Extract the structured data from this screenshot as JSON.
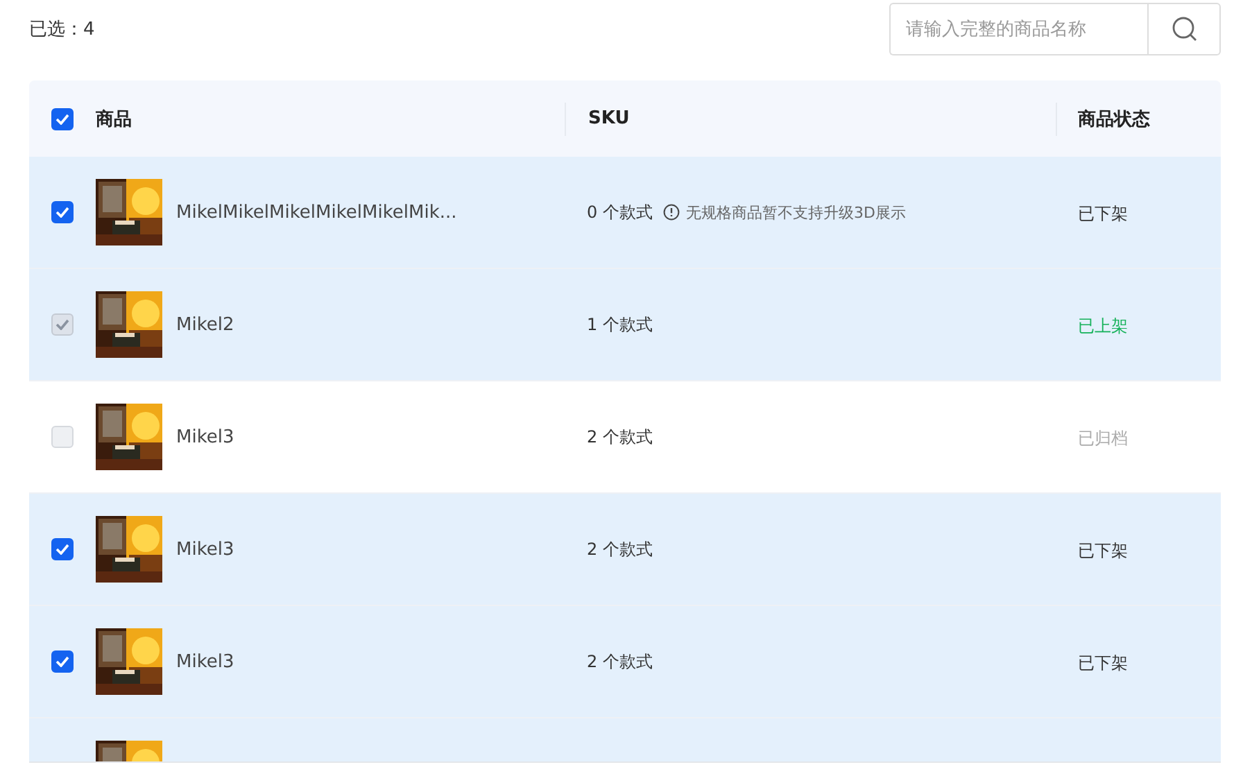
{
  "selection_count": "已选：4",
  "search": {
    "placeholder": "请输入完整的商品名称"
  },
  "table": {
    "header_checkbox": {
      "checked": true
    },
    "columns": [
      "商品",
      "SKU",
      "商品状态"
    ],
    "rows": [
      {
        "kind": "full",
        "selected": true,
        "checked": true,
        "disabled": false,
        "name": "MikelMikelMikelMikelMikelMik...",
        "sku": "0 个款式",
        "note": "无规格商品暂不支持升级3D展示",
        "status": "已下架",
        "color": "#333333"
      },
      {
        "kind": "full",
        "selected": true,
        "checked": true,
        "disabled": true,
        "name": "Mikel2",
        "sku": "1 个款式",
        "status": "已上架",
        "color": "#17b25b"
      },
      {
        "kind": "full",
        "selected": false,
        "checked": false,
        "disabled": true,
        "name": "Mikel3",
        "sku": "2 个款式",
        "status": "已归档",
        "color": "#aaaaaa"
      },
      {
        "kind": "full",
        "selected": true,
        "checked": true,
        "disabled": false,
        "name": "Mikel3",
        "sku": "2 个款式",
        "status": "已下架",
        "color": "#333333"
      },
      {
        "kind": "full",
        "selected": true,
        "checked": true,
        "disabled": false,
        "name": "Mikel3",
        "sku": "2 个款式",
        "status": "已下架",
        "color": "#333333"
      },
      {
        "kind": "cut",
        "selected": true
      }
    ]
  }
}
